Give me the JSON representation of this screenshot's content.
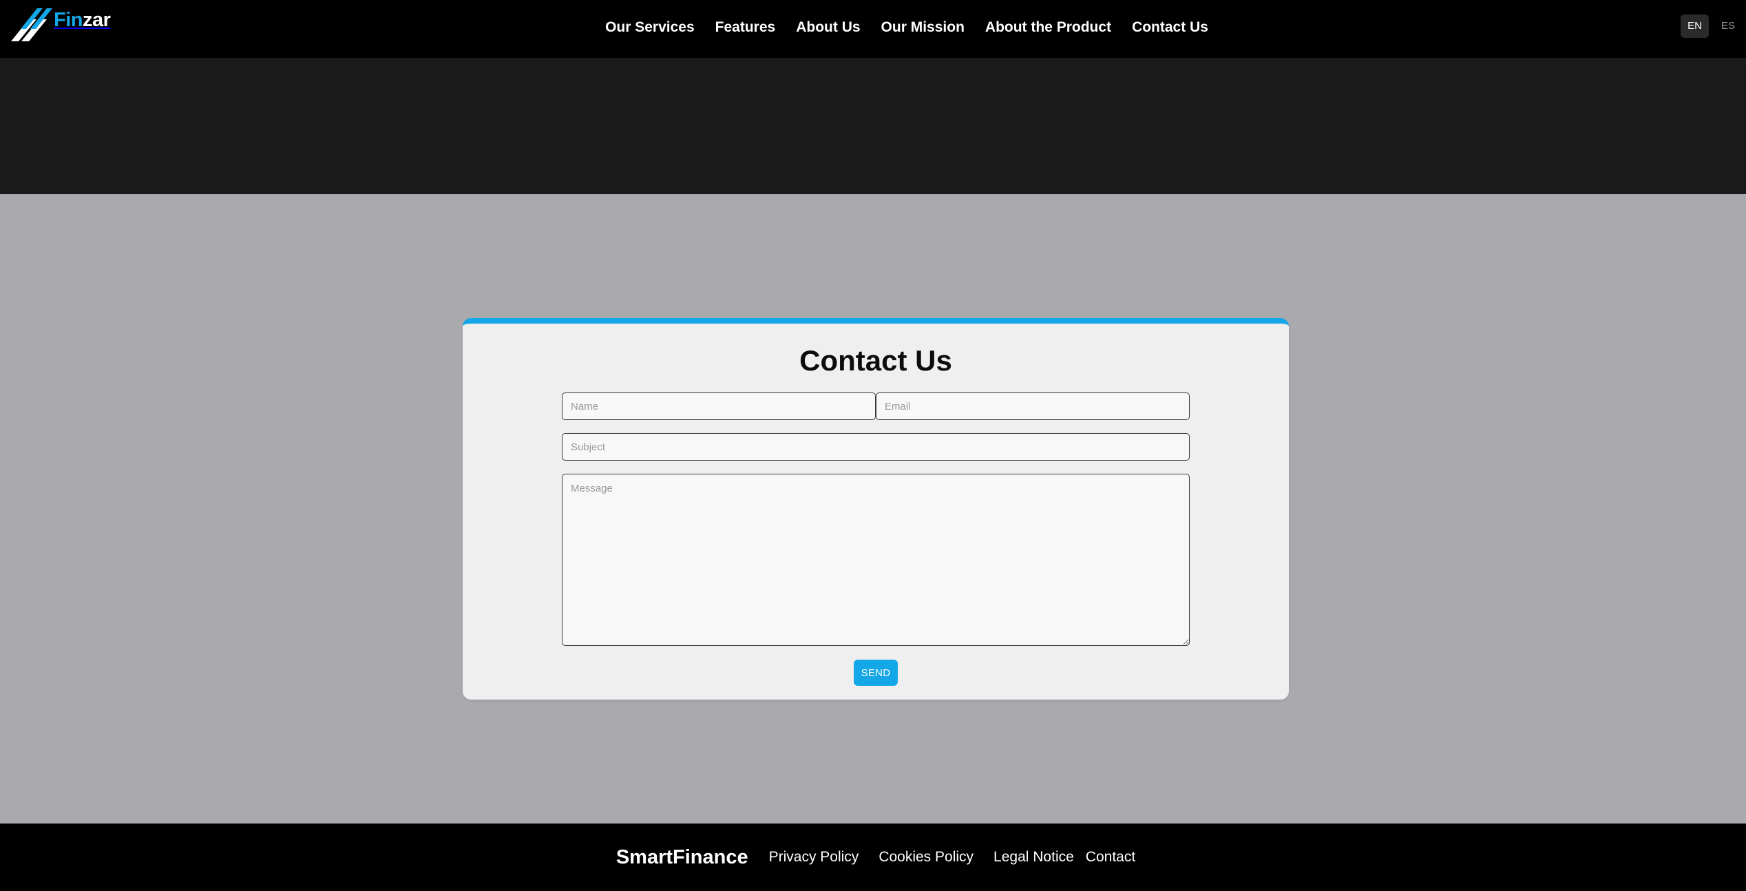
{
  "header": {
    "logo": {
      "text_part1": "Fin",
      "text_part2": "zar",
      "icon": "finzar-slash-logo-icon"
    },
    "nav": [
      {
        "label": "Our Services"
      },
      {
        "label": "Features"
      },
      {
        "label": "About Us"
      },
      {
        "label": "Our Mission"
      },
      {
        "label": "About the Product"
      },
      {
        "label": "Contact Us"
      }
    ],
    "languages": [
      {
        "label": "EN",
        "active": true
      },
      {
        "label": "ES",
        "active": false
      }
    ]
  },
  "contact": {
    "title": "Contact Us",
    "name_placeholder": "Name",
    "email_placeholder": "Email",
    "subject_placeholder": "Subject",
    "message_placeholder": "Message",
    "send_label": "SEND"
  },
  "footer": {
    "brand": "SmartFinance",
    "links": [
      {
        "label": "Privacy Policy"
      },
      {
        "label": "Cookies Policy"
      },
      {
        "label": "Legal Notice"
      },
      {
        "label": "Contact"
      }
    ]
  },
  "colors": {
    "accent": "#14a7e8",
    "navbar_bg": "#000000",
    "hero_band_bg": "#1a1a1a",
    "page_bg": "#aaaaae",
    "card_bg": "#efefef"
  }
}
